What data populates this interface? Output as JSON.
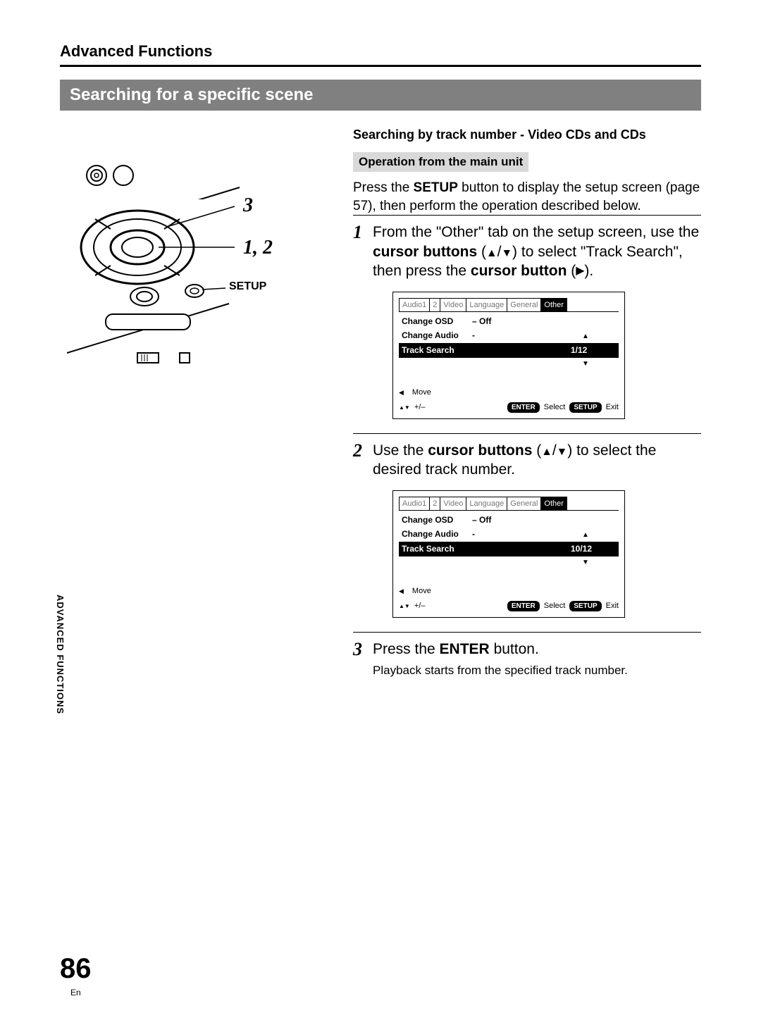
{
  "chapter": "Advanced Functions",
  "section_title": "Searching for a specific scene",
  "diagram": {
    "callout_3": "3",
    "callout_12": "1, 2",
    "callout_setup": "SETUP"
  },
  "subsection": "Searching by track number - Video CDs and CDs",
  "operation_heading": "Operation from the main unit",
  "intro": {
    "prefix": "Press the ",
    "bold": "SETUP",
    "suffix": " button to display the setup screen (page 57), then perform the operation described below."
  },
  "steps": {
    "s1": {
      "num": "1",
      "t1": "From the \"Other\" tab on the setup screen, use the ",
      "b1": "cursor buttons",
      "t2": " (",
      "t3": ") to select \"Track Search\", then press the ",
      "b2": "cursor button",
      "t4": " (",
      "t5": ")."
    },
    "s2": {
      "num": "2",
      "t1": "Use the ",
      "b1": "cursor buttons",
      "t2": " (",
      "t3": ") to select the desired track number."
    },
    "s3": {
      "num": "3",
      "t1": "Press the ",
      "b1": "ENTER",
      "t2": " button.",
      "small": "Playback starts from the specified track number."
    }
  },
  "osd": {
    "tabs": [
      "Audio1",
      "2",
      "Video",
      "Language",
      "General",
      "Other"
    ],
    "row1_label": "Change OSD",
    "row1_val": "– Off",
    "row2_label": "Change Audio",
    "row2_val": "-",
    "row3_label": "Track Search",
    "val_screen1": "1/12",
    "val_screen2": "10/12",
    "footer_move": "Move",
    "footer_plusminus": "+/–",
    "footer_enter": "ENTER",
    "footer_select": "Select",
    "footer_setup": "SETUP",
    "footer_exit": "Exit"
  },
  "side_tab": "ADVANCED FUNCTIONS",
  "page_number": "86",
  "lang": "En"
}
